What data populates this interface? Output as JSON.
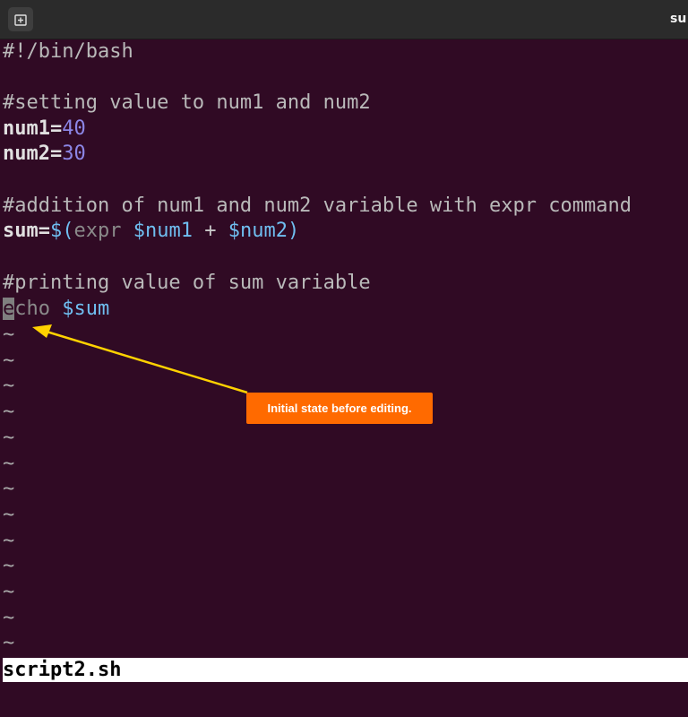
{
  "window": {
    "title": "su"
  },
  "icons": {
    "new_tab": "new-tab-icon"
  },
  "editor": {
    "shebang": "#!/bin/bash",
    "comment1": "#setting value to num1 and num2",
    "num1": {
      "name": "num1",
      "op": "=",
      "value": "40"
    },
    "num2": {
      "name": "num2",
      "op": "=",
      "value": "30"
    },
    "comment2": "#addition of num1 and num2 variable with expr command",
    "sum_line": {
      "name": "sum",
      "op": "=",
      "open": "$(",
      "cmd": "expr ",
      "var1": "$num1",
      "plus": " + ",
      "var2": "$num2",
      "close": ")"
    },
    "comment3": "#printing value of sum variable",
    "echo_line": {
      "cursor_char": "e",
      "rest_cmd": "cho ",
      "var": "$sum"
    },
    "tilde": "~",
    "tilde_count": 13
  },
  "status_bar": {
    "filename": "script2.sh"
  },
  "annotation": {
    "callout_text": "Initial state before editing.",
    "callout_color": "#ff6a00",
    "arrow_color": "#ffd200"
  },
  "colors": {
    "background": "#300a24",
    "number": "#8c86e6",
    "variable": "#6fbef0"
  }
}
